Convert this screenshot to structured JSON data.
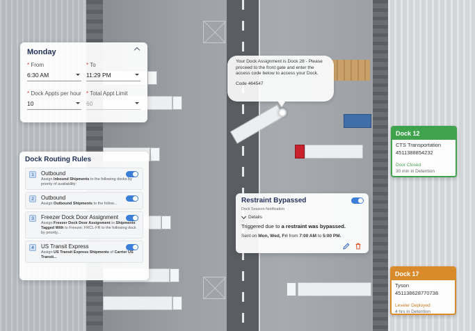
{
  "schedule": {
    "day": "Monday",
    "from_label": "From",
    "from_value": "6:30 AM",
    "to_label": "To",
    "to_value": "11:29 PM",
    "dock_appts_label": "Dock Appts per hour",
    "dock_appts_value": "10",
    "total_limit_label": "Total Appt Limit",
    "total_limit_value": "60"
  },
  "routing": {
    "title": "Dock Routing Rules",
    "rules": [
      {
        "num": "1",
        "title": "Outbound",
        "desc_pre": "Assign ",
        "desc_bold": "Inbound Shipments",
        "desc_post": " to the following docks by priority of availability:",
        "enabled": true
      },
      {
        "num": "2",
        "title": "Outbound",
        "desc_pre": "Assign ",
        "desc_bold": "Outbound Shipments",
        "desc_post": " to the follow...",
        "enabled": true
      },
      {
        "num": "3",
        "title": "Freezer Dock Door Assignment",
        "desc_pre": "Assign ",
        "desc_bold": "Freezer Dock Door Assignment",
        "desc_mid": " to ",
        "desc_bold2": "Shipments Tagged With",
        "desc_post": " to Freezer, FRCL-FR to the following dock by priority...",
        "enabled": true
      },
      {
        "num": "4",
        "title": "US Transit Express",
        "desc_pre": "Assign ",
        "desc_bold": "US Transit Express Shipments",
        "desc_mid": " of ",
        "desc_bold2": "Carrier US Transit...",
        "desc_post": "",
        "enabled": true
      }
    ]
  },
  "bubble": {
    "message": "Your Dock Assignment is Dock 28 - Please proceed to the front gate and enter the access code below to access your Dock.",
    "code": "Code 464547"
  },
  "restraint": {
    "title": "Restraint Bypassed",
    "subtitle": "Dock Session Notification",
    "details_label": "Details",
    "msg_pre": "Triggered due to ",
    "msg_bold": "a restraint was bypassed.",
    "sched_pre": "Sent on ",
    "sched_days": "Mon, Wed, Fri",
    "sched_from": " from ",
    "sched_start": "7:00 AM",
    "sched_to": " to ",
    "sched_end": "5:00 PM.",
    "enabled": true
  },
  "docks": [
    {
      "name": "Dock 12",
      "carrier": "CTS Transportation",
      "number": "4511388854232",
      "status": "Door Closed",
      "detention": "30 min in Detention",
      "color": "#3fa34d"
    },
    {
      "name": "Dock 17",
      "carrier": "Tyson",
      "number": "451138628770738",
      "status": "Leveler Deployed",
      "detention": "4 hrs in Detention",
      "color": "#d98a2b"
    }
  ],
  "icons": [
    "chevron-up-icon",
    "caret-down-icon",
    "toggle-switch",
    "pencil-icon",
    "trash-icon",
    "map-pin-icon"
  ]
}
